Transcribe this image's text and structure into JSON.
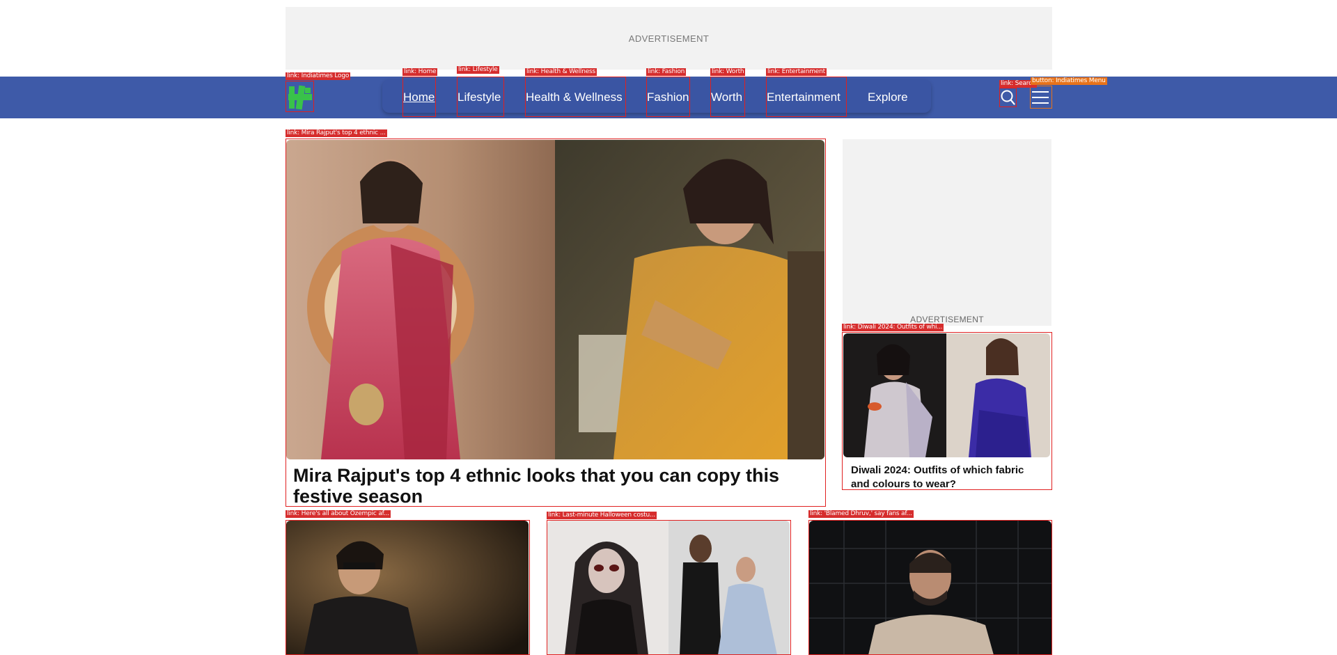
{
  "ads": {
    "top_label": "ADVERTISEMENT",
    "side_label": "ADVERTISEMENT"
  },
  "nav": {
    "items": [
      {
        "label": "Home",
        "active": true
      },
      {
        "label": "Lifestyle"
      },
      {
        "label": "Health & Wellness"
      },
      {
        "label": "Fashion"
      },
      {
        "label": "Worth"
      },
      {
        "label": "Entertainment"
      },
      {
        "label": "Explore"
      }
    ]
  },
  "hero": {
    "title": "Mira Rajput's top 4 ethnic looks that you can copy this festive season"
  },
  "side_card": {
    "title": "Diwali 2024: Outfits of which fabric and colours to wear?"
  },
  "annotations": {
    "logo": "link: Indiatimes Logo",
    "home": "link: Home",
    "lifestyle": "link: Lifestyle",
    "health": "link: Health & Wellness",
    "fashion": "link: Fashion",
    "worth": "link: Worth",
    "entertainment": "link: Entertainment",
    "search": "link: Search",
    "menu": "button: Indiatimes Menu",
    "hero": "link: Mira Rajput's top 4 ethnic ...",
    "side": "link: Diwali 2024: Outfits of whi...",
    "card1": "link: Here's all about Ozempic af...",
    "card2": "link: Last-minute Halloween costu...",
    "card3": "link: 'Blamed Dhruv,' say fans af..."
  },
  "colors": {
    "nav_bg": "#3e5aa8",
    "logo_green": "#39c24a",
    "annotation_red": "#d62d2d",
    "annotation_orange": "#e8731a"
  }
}
